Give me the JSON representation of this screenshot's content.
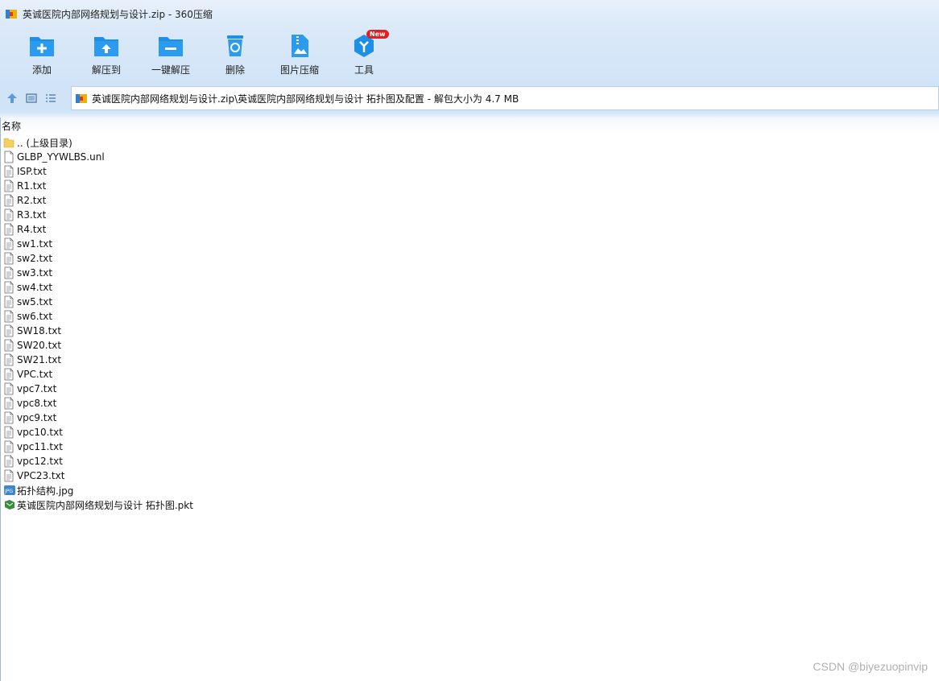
{
  "window": {
    "title": "英诚医院内部网络规划与设计.zip - 360压缩"
  },
  "toolbar": {
    "buttons": [
      {
        "label": "添加",
        "icon": "add-folder-icon"
      },
      {
        "label": "解压到",
        "icon": "extract-to-icon"
      },
      {
        "label": "一键解压",
        "icon": "one-click-extract-icon"
      },
      {
        "label": "删除",
        "icon": "delete-icon"
      },
      {
        "label": "图片压缩",
        "icon": "image-compress-icon"
      },
      {
        "label": "工具",
        "icon": "tools-icon",
        "badge": "New"
      }
    ]
  },
  "addressbar": {
    "path": "英诚医院内部网络规划与设计.zip\\英诚医院内部网络规划与设计 拓扑图及配置 - 解包大小为 4.7 MB"
  },
  "list": {
    "header_name": "名称",
    "files": [
      {
        "name": ".. (上级目录)",
        "type": "folder"
      },
      {
        "name": "GLBP_YYWLBS.unl",
        "type": "file"
      },
      {
        "name": "ISP.txt",
        "type": "txt"
      },
      {
        "name": "R1.txt",
        "type": "txt"
      },
      {
        "name": "R2.txt",
        "type": "txt"
      },
      {
        "name": "R3.txt",
        "type": "txt"
      },
      {
        "name": "R4.txt",
        "type": "txt"
      },
      {
        "name": "sw1.txt",
        "type": "txt"
      },
      {
        "name": "sw2.txt",
        "type": "txt"
      },
      {
        "name": "sw3.txt",
        "type": "txt"
      },
      {
        "name": "sw4.txt",
        "type": "txt"
      },
      {
        "name": "sw5.txt",
        "type": "txt"
      },
      {
        "name": "sw6.txt",
        "type": "txt"
      },
      {
        "name": "SW18.txt",
        "type": "txt"
      },
      {
        "name": "SW20.txt",
        "type": "txt"
      },
      {
        "name": "SW21.txt",
        "type": "txt"
      },
      {
        "name": "VPC.txt",
        "type": "txt"
      },
      {
        "name": "vpc7.txt",
        "type": "txt"
      },
      {
        "name": "vpc8.txt",
        "type": "txt"
      },
      {
        "name": "vpc9.txt",
        "type": "txt"
      },
      {
        "name": "vpc10.txt",
        "type": "txt"
      },
      {
        "name": "vpc11.txt",
        "type": "txt"
      },
      {
        "name": "vpc12.txt",
        "type": "txt"
      },
      {
        "name": "VPC23.txt",
        "type": "txt"
      },
      {
        "name": "拓扑结构.jpg",
        "type": "jpg"
      },
      {
        "name": "英诚医院内部网络规划与设计 拓扑图.pkt",
        "type": "pkt"
      }
    ]
  },
  "watermark": "CSDN @biyezuopinvip",
  "colors": {
    "accent": "#1e8fe6",
    "toolbar_bg": "#d6e7f8",
    "badge": "#e02020"
  }
}
